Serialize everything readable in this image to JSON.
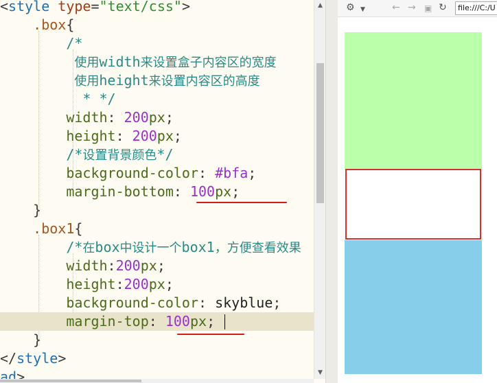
{
  "editor": {
    "lines": [
      [
        [
          "tok-punc",
          "<"
        ],
        [
          "tok-tag",
          "style"
        ],
        [
          "tok-plain",
          " "
        ],
        [
          "tok-attr",
          "type"
        ],
        [
          "tok-punc",
          "="
        ],
        [
          "tok-str",
          "\"text/css\""
        ],
        [
          "tok-punc",
          ">"
        ]
      ],
      [
        [
          "tok-plain",
          "    "
        ],
        [
          "tok-sel",
          ".box"
        ],
        [
          "tok-punc",
          "{"
        ]
      ],
      [
        [
          "tok-plain",
          "        "
        ],
        [
          "tok-comment",
          "/*"
        ]
      ],
      [
        [
          "tok-plain",
          "         "
        ],
        [
          "tok-comment cjk",
          "使用"
        ],
        [
          "tok-comment",
          "width"
        ],
        [
          "tok-comment cjk",
          "来设置盒子内容区的宽度"
        ]
      ],
      [
        [
          "tok-plain",
          "         "
        ],
        [
          "tok-comment cjk",
          "使用"
        ],
        [
          "tok-comment",
          "height"
        ],
        [
          "tok-comment cjk",
          "来设置内容区的高度"
        ]
      ],
      [
        [
          "tok-plain",
          "          "
        ],
        [
          "tok-comment",
          "* */"
        ]
      ],
      [
        [
          "tok-plain",
          "        "
        ],
        [
          "tok-prop",
          "width"
        ],
        [
          "tok-punc",
          ": "
        ],
        [
          "tok-num",
          "200"
        ],
        [
          "tok-prop",
          "px"
        ],
        [
          "tok-punc",
          ";"
        ]
      ],
      [
        [
          "tok-plain",
          "        "
        ],
        [
          "tok-prop",
          "height"
        ],
        [
          "tok-punc",
          ": "
        ],
        [
          "tok-num",
          "200"
        ],
        [
          "tok-prop",
          "px"
        ],
        [
          "tok-punc",
          ";"
        ]
      ],
      [
        [
          "tok-plain",
          "        "
        ],
        [
          "tok-comment",
          "/*"
        ],
        [
          "tok-comment cjk",
          "设置背景颜色"
        ],
        [
          "tok-comment",
          "*/"
        ]
      ],
      [
        [
          "tok-plain",
          "        "
        ],
        [
          "tok-prop",
          "background-color"
        ],
        [
          "tok-punc",
          ": "
        ],
        [
          "tok-num",
          "#bfa"
        ],
        [
          "tok-punc",
          ";"
        ]
      ],
      [
        [
          "tok-plain",
          "        "
        ],
        [
          "tok-prop",
          "margin-bottom"
        ],
        [
          "tok-punc",
          ": "
        ],
        [
          "tok-num",
          "100"
        ],
        [
          "tok-prop",
          "px"
        ],
        [
          "tok-punc",
          ";"
        ]
      ],
      [
        [
          "tok-plain",
          "    "
        ],
        [
          "tok-punc",
          "}"
        ]
      ],
      [
        [
          "tok-plain",
          "    "
        ],
        [
          "tok-sel",
          ".box1"
        ],
        [
          "tok-punc",
          "{"
        ]
      ],
      [
        [
          "tok-plain",
          "        "
        ],
        [
          "tok-comment",
          "/*"
        ],
        [
          "tok-comment cjk",
          "在"
        ],
        [
          "tok-comment",
          "box"
        ],
        [
          "tok-comment cjk",
          "中设计一个"
        ],
        [
          "tok-comment",
          "box1"
        ],
        [
          "tok-comment cjk",
          "，方便查看效果"
        ]
      ],
      [
        [
          "tok-plain",
          "        "
        ],
        [
          "tok-prop",
          "width"
        ],
        [
          "tok-punc",
          ":"
        ],
        [
          "tok-num",
          "200"
        ],
        [
          "tok-prop",
          "px"
        ],
        [
          "tok-punc",
          ";"
        ]
      ],
      [
        [
          "tok-plain",
          "        "
        ],
        [
          "tok-prop",
          "height"
        ],
        [
          "tok-punc",
          ":"
        ],
        [
          "tok-num",
          "200"
        ],
        [
          "tok-prop",
          "px"
        ],
        [
          "tok-punc",
          ";"
        ]
      ],
      [
        [
          "tok-plain",
          "        "
        ],
        [
          "tok-prop",
          "background-color"
        ],
        [
          "tok-punc",
          ": "
        ],
        [
          "tok-plain",
          "skyblue"
        ],
        [
          "tok-punc",
          ";"
        ]
      ],
      [
        [
          "tok-plain",
          "        "
        ],
        [
          "tok-prop",
          "margin-top"
        ],
        [
          "tok-punc",
          ": "
        ],
        [
          "tok-num",
          "100"
        ],
        [
          "tok-prop",
          "px"
        ],
        [
          "tok-punc",
          ";"
        ]
      ],
      [
        [
          "tok-plain",
          "    "
        ],
        [
          "tok-punc",
          "}"
        ]
      ],
      [
        [
          "tok-punc",
          "</"
        ],
        [
          "tok-tag",
          "style"
        ],
        [
          "tok-punc",
          ">"
        ]
      ],
      [
        [
          "tok-tag",
          "ad"
        ],
        [
          "tok-punc",
          ">"
        ]
      ]
    ],
    "current_line": 17
  },
  "browser": {
    "url": "file:///C:/U",
    "icons": [
      "gear-icon",
      "chevron-down-icon",
      "back-icon",
      "forward-icon",
      "stop-icon",
      "refresh-icon"
    ]
  },
  "preview": {
    "box_color": "#bbffaa",
    "box1_color": "#87ceeb",
    "highlight_color": "#d32f2f"
  },
  "colors": {
    "editor_bg": "#fdfbf2",
    "underline": "#d21b1b"
  }
}
